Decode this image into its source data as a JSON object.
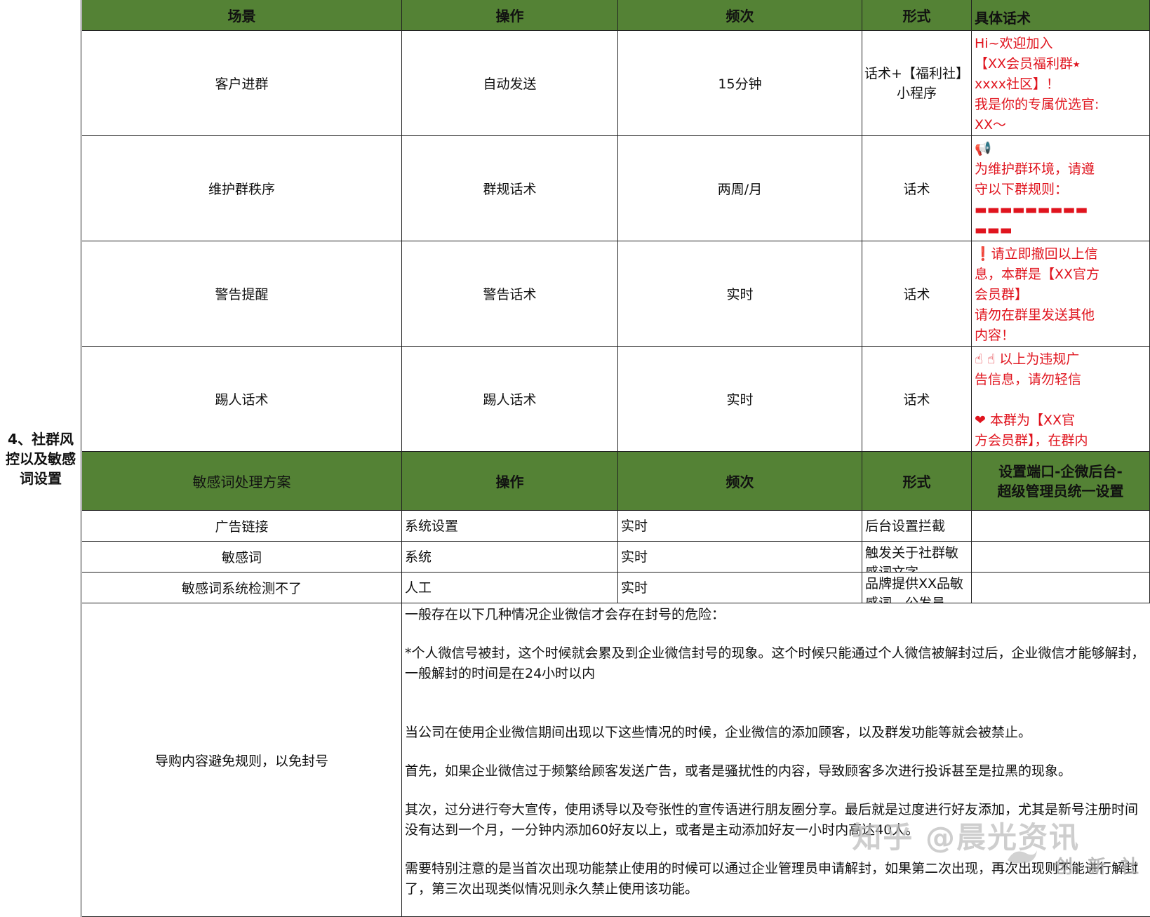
{
  "section_label": "4、社群风\n控以及敏感\n词设置",
  "table1": {
    "headers": [
      "场景",
      "操作",
      "频次",
      "形式",
      "具体话术"
    ],
    "rows": [
      {
        "scene": "客户进群",
        "action": "自动发送",
        "freq": "15分钟",
        "form": "话术+【福利社】\n小程序",
        "script": "Hi~欢迎加入\n【XX会员福利群⭑\nxxxx社区】！\n我是你的专属优选官:\nXX～"
      },
      {
        "scene": "维护群秩序",
        "action": "群规话术",
        "freq": "两周/月",
        "form": "话术",
        "script": "📢\n为维护群环境，请遵\n守以下群规则：\n▬▬▬▬▬▬▬▬▬\n▬▬▬"
      },
      {
        "scene": "警告提醒",
        "action": "警告话术",
        "freq": "实时",
        "form": "话术",
        "script": "❗请立即撤回以上信\n息，本群是【XX官方\n会员群】\n请勿在群里发送其他\n内容！"
      },
      {
        "scene": "踢人话术",
        "action": "踢人话术",
        "freq": "实时",
        "form": "话术",
        "script": "☝ ☝ 以上为违规广\n告信息，请勿轻信\n\n❤   本群为【XX官\n方会员群】，在群内"
      }
    ]
  },
  "table2": {
    "headers": [
      "敏感词处理方案",
      "操作",
      "频次",
      "形式",
      "设置端口-企微后台-\n超级管理员统一设置"
    ],
    "rows": [
      {
        "name": "广告链接",
        "action": "系统设置",
        "freq": "实时",
        "form": "后台设置拦截",
        "setting": ""
      },
      {
        "name": "敏感词",
        "action": "系统",
        "freq": "实时",
        "form": "触发关于社群敏\n感词文字",
        "setting": ""
      },
      {
        "name": "敏感词系统检测不了",
        "action": "人工",
        "freq": "实时",
        "form": "品牌提供XX品敏\n感词，公发员",
        "setting": ""
      }
    ]
  },
  "rules": {
    "title": "导购内容避免规则，以免封号",
    "paragraphs": [
      "一般存在以下几种情况企业微信才会存在封号的危险：",
      "*个人微信号被封，这个时候就会累及到企业微信封号的现象。这个时候只能通过个人微信被解封过后，企业微信才能够解封，一般解封的时间是在24小时以内",
      "当公司在使用企业微信期间出现以下这些情况的时候，企业微信的添加顾客，以及群发功能等就会被禁止。",
      "首先，如果企业微信过于频繁给顾客发送广告，或者是骚扰性的内容，导致顾客多次进行投诉甚至是拉黑的现象。",
      "其次，过分进行夸大宣传，使用诱导以及夸张性的宣传语进行朋友圈分享。最后就是过度进行好友添加，尤其是新号注册时间没有达到一个月，一分钟内添加60好友以上，或者是主动添加好友一小时内高达40人。",
      "需要特别注意的是当首次出现功能禁止使用的时候可以通过企业管理员申请解封，如果第二次出现，再次出现则不能进行解封了，第三次出现类似情况则永久禁止使用该功能。"
    ]
  },
  "watermark": {
    "text": "知乎 @晨光资讯",
    "sub": "创 新 社"
  }
}
